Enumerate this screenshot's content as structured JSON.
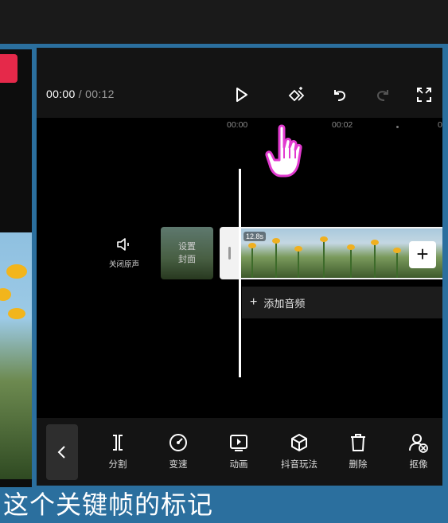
{
  "player": {
    "current_time": "00:00",
    "separator": "/",
    "total_time": "00:12"
  },
  "ruler": {
    "label_0": "00:00",
    "label_1": "00:02",
    "label_2": "0"
  },
  "timeline": {
    "mute_label": "关闭原声",
    "cover_label_line1": "设置",
    "cover_label_line2": "封面",
    "clip_duration": "12.8s",
    "add_clip_symbol": "+",
    "add_audio_label": "添加音频",
    "add_audio_symbol": "+"
  },
  "toolbar": {
    "items": [
      {
        "label": "分割",
        "icon": "split-icon"
      },
      {
        "label": "变速",
        "icon": "speed-icon"
      },
      {
        "label": "动画",
        "icon": "animation-icon"
      },
      {
        "label": "抖音玩法",
        "icon": "cube-icon"
      },
      {
        "label": "删除",
        "icon": "trash-icon"
      },
      {
        "label": "抠像",
        "icon": "cutout-icon"
      }
    ]
  },
  "caption": {
    "text": "这个关键帧的标记"
  },
  "colors": {
    "background": "#2b6f9e",
    "accent_red": "#e5294a",
    "cursor_pink": "#e23bd0"
  }
}
